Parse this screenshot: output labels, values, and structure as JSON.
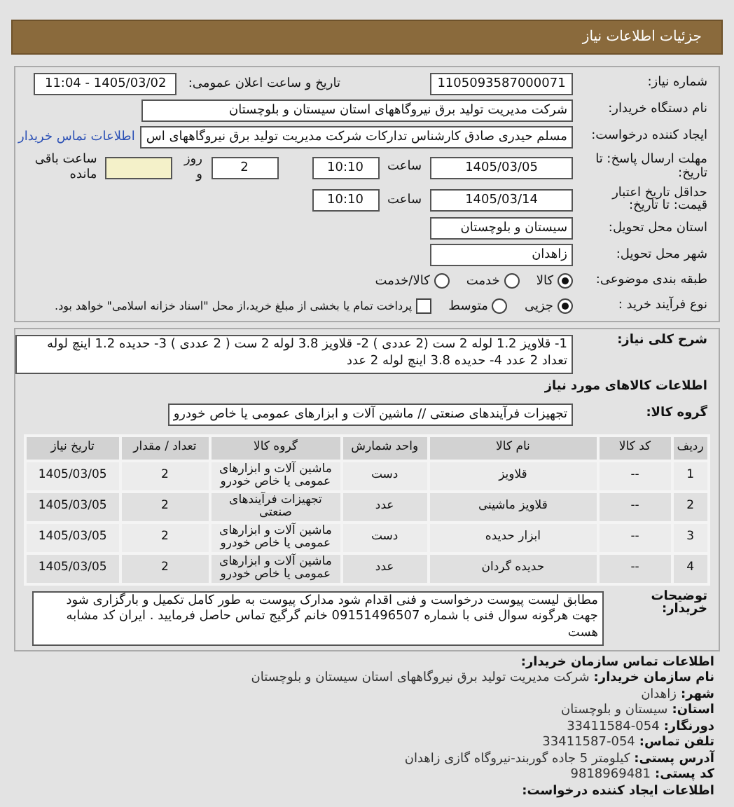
{
  "header": {
    "title": "جزئیات اطلاعات نیاز"
  },
  "need_number": {
    "label": "شماره نیاز:",
    "value": "1105093587000071"
  },
  "announce": {
    "label": "تاریخ و ساعت اعلان عمومی:",
    "value": "1405/03/02 - 11:04"
  },
  "buyer": {
    "label": "نام دستگاه خریدار:",
    "value": "شرکت مدیریت تولید برق نیروگاههای استان سیستان و بلوچستان"
  },
  "creator": {
    "label": "ایجاد کننده درخواست:",
    "value": "مسلم حیدری صادق کارشناس تدارکات شرکت مدیریت تولید برق نیروگاههای اس",
    "link": "اطلاعات تماس خریدار"
  },
  "deadline": {
    "label": "مهلت ارسال پاسخ: تا تاریخ:",
    "date": "1405/03/05",
    "time_label": "ساعت",
    "time": "10:10",
    "days": "2",
    "days_label": "روز و",
    "remaining_label": "ساعت باقی مانده"
  },
  "validity": {
    "label": "حداقل تاریخ اعتبار قیمت: تا تاریخ:",
    "date": "1405/03/14",
    "time_label": "ساعت",
    "time": "10:10"
  },
  "province": {
    "label": "استان محل تحویل:",
    "value": "سیستان و بلوچستان"
  },
  "city": {
    "label": "شهر محل تحویل:",
    "value": "زاهدان"
  },
  "category": {
    "label": "طبقه بندی موضوعی:",
    "options": [
      {
        "label": "کالا",
        "selected": true
      },
      {
        "label": "خدمت",
        "selected": false
      },
      {
        "label": "کالا/خدمت",
        "selected": false
      }
    ]
  },
  "purchase_type": {
    "label": "نوع فرآیند خرید :",
    "options": [
      {
        "label": "جزیی",
        "selected": true
      },
      {
        "label": "متوسط",
        "selected": false
      }
    ],
    "treasury": {
      "label": "پرداخت تمام یا بخشی از مبلغ خرید،از محل \"اسناد خزانه اسلامی\" خواهد بود.",
      "checked": false
    }
  },
  "description": {
    "label": "شرح کلی نیاز:",
    "value": "1- قلاویز 1.2 لوله 2 ست (2 عددی ) 2- قلاویز 3.8 لوله 2 ست ( 2 عددی ) 3- حدیده 1.2 اینچ لوله تعداد 2 عدد 4- حدیده 3.8 اینچ لوله 2 عدد"
  },
  "goods_heading": "اطلاعات کالاهای مورد نیاز",
  "goods_group": {
    "label": "گروه کالا:",
    "value": "تجهیزات فرآیندهای صنعتی // ماشین آلات و ابزارهای عمومی یا خاص خودرو"
  },
  "table": {
    "columns": [
      "ردیف",
      "کد کالا",
      "نام کالا",
      "واحد شمارش",
      "گروه کالا",
      "تعداد / مقدار",
      "تاریخ نیاز"
    ],
    "rows": [
      [
        "1",
        "--",
        "قلاویز",
        "دست",
        "ماشین آلات و ابزارهای عمومی یا خاص خودرو",
        "2",
        "1405/03/05"
      ],
      [
        "2",
        "--",
        "قلاویز ماشینی",
        "عدد",
        "تجهیزات فرآیندهای صنعتی",
        "2",
        "1405/03/05"
      ],
      [
        "3",
        "--",
        "ابزار حدیده",
        "دست",
        "ماشین آلات و ابزارهای عمومی یا خاص خودرو",
        "2",
        "1405/03/05"
      ],
      [
        "4",
        "--",
        "حدیده گردان",
        "عدد",
        "ماشین آلات و ابزارهای عمومی یا خاص خودرو",
        "2",
        "1405/03/05"
      ]
    ]
  },
  "notes": {
    "label": "توضیحات خریدار:",
    "value": "مطابق لیست پیوست درخواست و فنی اقدام شود مدارک پیوست به طور کامل تکمیل و بارگزاری شود جهت هرگونه سوال فنی با شماره 09151496507 خانم گرگیج تماس حاصل فرمایید . ایران کد مشابه هست"
  },
  "contact": {
    "heading": "اطلاعات تماس سازمان خریدار:",
    "lines": [
      {
        "label": "نام سازمان خریدار:",
        "value": "شرکت مدیریت تولید برق نیروگاههای استان سیستان و بلوچستان"
      },
      {
        "label": "شهر:",
        "value": "زاهدان"
      },
      {
        "label": "استان:",
        "value": "سیستان و بلوچستان"
      },
      {
        "label": "دورنگار:",
        "value": "054-33411584"
      },
      {
        "label": "تلفن تماس:",
        "value": "054-33411587"
      },
      {
        "label": "آدرس پستی:",
        "value": "کیلومتر 5 جاده گوربند-نیروگاه گازی زاهدان"
      },
      {
        "label": "کد پستی:",
        "value": "9818969481"
      }
    ],
    "footer_heading": "اطلاعات ایجاد کننده درخواست:"
  }
}
